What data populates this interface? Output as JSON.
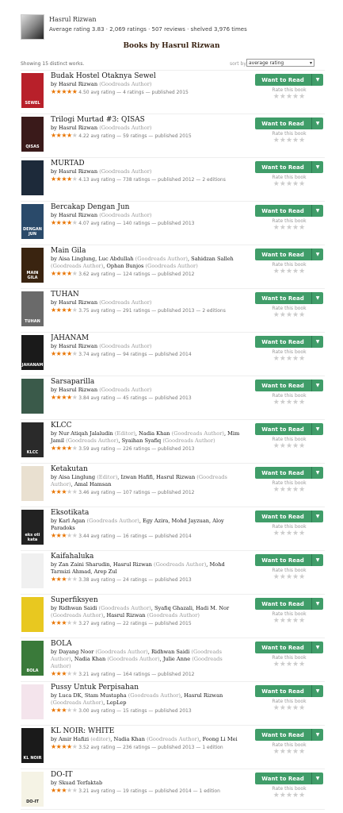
{
  "author": {
    "name": "Hasrul Rizwan",
    "stats": "Average rating 3.83 · 2,069 ratings · 507 reviews · shelved 3,976 times"
  },
  "page_title": "Books by Hasrul Rizwan",
  "showing": "Showing 15 distinct works.",
  "sort": {
    "label": "sort by",
    "value": "average rating"
  },
  "button_label": "Want to Read",
  "rate_label": "Rate this book",
  "books": [
    {
      "title": "Budak Hostel Otaknya Sewel",
      "by": "by",
      "authors": [
        {
          "name": "Hasrul Rizwan",
          "role": "(Goodreads Author)"
        }
      ],
      "rating": 4.5,
      "meta": "4.50 avg rating — 4 ratings — published 2015",
      "cover_color": "#b8202a",
      "cover_text": "SEWEL"
    },
    {
      "title": "Trilogi Murtad #3: QISAS",
      "by": "by",
      "authors": [
        {
          "name": "Hasrul Rizwan",
          "role": "(Goodreads Author)"
        }
      ],
      "rating": 4.22,
      "meta": "4.22 avg rating — 59 ratings — published 2015",
      "cover_color": "#3a1a1a",
      "cover_text": "QISAS"
    },
    {
      "title": "MURTAD",
      "by": "by",
      "authors": [
        {
          "name": "Hasrul Rizwan",
          "role": "(Goodreads Author)"
        }
      ],
      "rating": 4.13,
      "meta": "4.13 avg rating — 738 ratings — published 2012 — 2 editions",
      "cover_color": "#1d2a3a",
      "cover_text": ""
    },
    {
      "title": "Bercakap Dengan Jun",
      "by": "by",
      "authors": [
        {
          "name": "Hasrul Rizwan",
          "role": "(Goodreads Author)"
        }
      ],
      "rating": 4.07,
      "meta": "4.07 avg rating — 140 ratings — published 2013",
      "cover_color": "#2a4a6a",
      "cover_text": "DENGAN JUN"
    },
    {
      "title": "Main Gila",
      "by": "by",
      "authors": [
        {
          "name": "Aisa Linglung",
          "role": ""
        },
        {
          "name": "Luc Abdullah",
          "role": "(Goodreads Author)"
        },
        {
          "name": "Sahidzan Salleh",
          "role": "(Goodreads Author)"
        },
        {
          "name": "Ophan Bunjos",
          "role": "(Goodreads Author)"
        }
      ],
      "rating": 3.62,
      "meta": "3.62 avg rating — 124 ratings — published 2012",
      "cover_color": "#3a2410",
      "cover_text": "MAIN GILA"
    },
    {
      "title": "TUHAN",
      "by": "by",
      "authors": [
        {
          "name": "Hasrul Rizwan",
          "role": "(Goodreads Author)"
        }
      ],
      "rating": 3.75,
      "meta": "3.75 avg rating — 291 ratings — published 2013 — 2 editions",
      "cover_color": "#6a6a6a",
      "cover_text": "TUHAN"
    },
    {
      "title": "JAHANAM",
      "by": "by",
      "authors": [
        {
          "name": "Hasrul Rizwan",
          "role": "(Goodreads Author)"
        }
      ],
      "rating": 3.74,
      "meta": "3.74 avg rating — 94 ratings — published 2014",
      "cover_color": "#1a1a1a",
      "cover_text": "JAHANAM"
    },
    {
      "title": "Sarsaparilla",
      "by": "by",
      "authors": [
        {
          "name": "Hasrul Rizwan",
          "role": "(Goodreads Author)"
        }
      ],
      "rating": 3.84,
      "meta": "3.84 avg rating — 45 ratings — published 2013",
      "cover_color": "#3a5a4a",
      "cover_text": ""
    },
    {
      "title": "KLCC",
      "by": "by",
      "authors": [
        {
          "name": "Nur Atiqah Jalaludin",
          "role": "(Editor)"
        },
        {
          "name": "Nadia Khan",
          "role": "(Goodreads Author)"
        },
        {
          "name": "Mim Jamil",
          "role": "(Goodreads Author)"
        },
        {
          "name": "Syaihan Syafiq",
          "role": "(Goodreads Author)"
        }
      ],
      "rating": 3.59,
      "meta": "3.59 avg rating — 226 ratings — published 2013",
      "cover_color": "#2a2a2a",
      "cover_text": "KLCC"
    },
    {
      "title": "Ketakutan",
      "by": "by",
      "authors": [
        {
          "name": "Aisa Linglung",
          "role": "(Editor)"
        },
        {
          "name": "Izwan Hafifi",
          "role": ""
        },
        {
          "name": "Hasrul Rizwan",
          "role": "(Goodreads Author)"
        },
        {
          "name": "Amal Hamsan",
          "role": ""
        }
      ],
      "rating": 3.46,
      "meta": "3.46 avg rating — 107 ratings — published 2012",
      "cover_color": "#e9e0d0",
      "cover_text": ""
    },
    {
      "title": "Eksotikata",
      "by": "by",
      "authors": [
        {
          "name": "Karl Agan",
          "role": "(Goodreads Author)"
        },
        {
          "name": "Egy Azira",
          "role": ""
        },
        {
          "name": "Mohd Jayzuan",
          "role": ""
        },
        {
          "name": "Aloy Paradoks",
          "role": ""
        }
      ],
      "rating": 3.44,
      "meta": "3.44 avg rating — 16 ratings — published 2014",
      "cover_color": "#222222",
      "cover_text": "eks oti kata"
    },
    {
      "title": "Kaifahaluka",
      "by": "by",
      "authors": [
        {
          "name": "Zan Zaini Sharudin",
          "role": ""
        },
        {
          "name": "Hasrul Rizwan",
          "role": "(Goodreads Author)"
        },
        {
          "name": "Mohd Tarmizi Ahmad",
          "role": ""
        },
        {
          "name": "Arep Zul",
          "role": ""
        }
      ],
      "rating": 3.38,
      "meta": "3.38 avg rating — 24 ratings — published 2013",
      "cover_color": "#f0f0f0",
      "cover_text": ""
    },
    {
      "title": "Superfiksyen",
      "by": "by",
      "authors": [
        {
          "name": "Ridhwan Saidi",
          "role": "(Goodreads Author)"
        },
        {
          "name": "Syafiq Ghazali",
          "role": ""
        },
        {
          "name": "Hadi M. Nor",
          "role": "(Goodreads Author)"
        },
        {
          "name": "Hasrul Rizwan",
          "role": "(Goodreads Author)"
        }
      ],
      "rating": 3.27,
      "meta": "3.27 avg rating — 22 ratings — published 2015",
      "cover_color": "#e8c820",
      "cover_text": ""
    },
    {
      "title": "BOLA",
      "by": "by",
      "authors": [
        {
          "name": "Dayang Noor",
          "role": "(Goodreads Author)"
        },
        {
          "name": "Ridhwan Saidi",
          "role": "(Goodreads Author)"
        },
        {
          "name": "Nadia Khan",
          "role": "(Goodreads Author)"
        },
        {
          "name": "Julie Anne",
          "role": "(Goodreads Author)"
        }
      ],
      "rating": 3.21,
      "meta": "3.21 avg rating — 164 ratings — published 2012",
      "cover_color": "#3a7a3a",
      "cover_text": "BOLA"
    },
    {
      "title": "Pussy Untuk Perpisahan",
      "by": "by",
      "authors": [
        {
          "name": "Luca DK",
          "role": ""
        },
        {
          "name": "Stam Mustapha",
          "role": "(Goodreads Author)"
        },
        {
          "name": "Hasrul Rizwan",
          "role": "(Goodreads Author)"
        },
        {
          "name": "LepLep",
          "role": ""
        }
      ],
      "rating": 3.0,
      "meta": "3.00 avg rating — 15 ratings — published 2013",
      "cover_color": "#f4e4ec",
      "cover_text": ""
    },
    {
      "title": "KL NOIR: WHITE",
      "by": "by",
      "authors": [
        {
          "name": "Amir Hafizi",
          "role": "(editor)"
        },
        {
          "name": "Nadia Khan",
          "role": "(Goodreads Author)"
        },
        {
          "name": "Foong Li Mei",
          "role": ""
        }
      ],
      "rating": 3.52,
      "meta": "3.52 avg rating — 236 ratings — published 2013 — 1 edition",
      "cover_color": "#1a1a1a",
      "cover_text": "KL NOIR"
    },
    {
      "title": "DO-IT",
      "by": "by",
      "authors": [
        {
          "name": "Skuad Terfaktab",
          "role": ""
        }
      ],
      "rating": 3.21,
      "meta": "3.21 avg rating — 19 ratings — published 2014 — 1 edition",
      "cover_color": "#f5f3e5",
      "cover_text": "DO-IT"
    }
  ]
}
